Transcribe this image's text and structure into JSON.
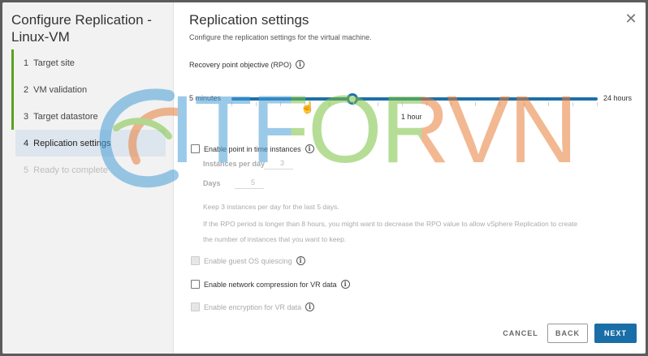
{
  "nav": {
    "title": "Configure Replication - Linux-VM",
    "steps": [
      {
        "num": "1",
        "label": "Target site"
      },
      {
        "num": "2",
        "label": "VM validation"
      },
      {
        "num": "3",
        "label": "Target datastore"
      },
      {
        "num": "4",
        "label": "Replication settings"
      },
      {
        "num": "5",
        "label": "Ready to complete"
      }
    ]
  },
  "header": {
    "title": "Replication settings",
    "subtitle": "Configure the replication settings for the virtual machine."
  },
  "rpo": {
    "label": "Recovery point objective (RPO)",
    "min_label": "5 minutes",
    "max_label": "24 hours",
    "current_label": "1 hour",
    "value_fraction": 0.33
  },
  "pit": {
    "label": "Enable point in time instances",
    "instances_label": "Instances per day",
    "instances_value": "3",
    "days_label": "Days",
    "days_value": "5",
    "note1": "Keep 3 instances per day for the last 5 days.",
    "note2": "If the RPO period is longer than 8 hours, you might want to decrease the RPO value to allow vSphere Replication to create",
    "note3": "the number of instances that you want to keep."
  },
  "options": {
    "quiescing": "Enable guest OS quiescing",
    "compression": "Enable network compression for VR data",
    "encryption": "Enable encryption for VR data"
  },
  "footer": {
    "cancel": "CANCEL",
    "back": "BACK",
    "next": "NEXT"
  },
  "watermark": {
    "text": "ITFORVN"
  },
  "colors": {
    "accent": "#1a6ea8",
    "done_step": "#5aa220",
    "active_step_bg": "#dde6ee"
  }
}
